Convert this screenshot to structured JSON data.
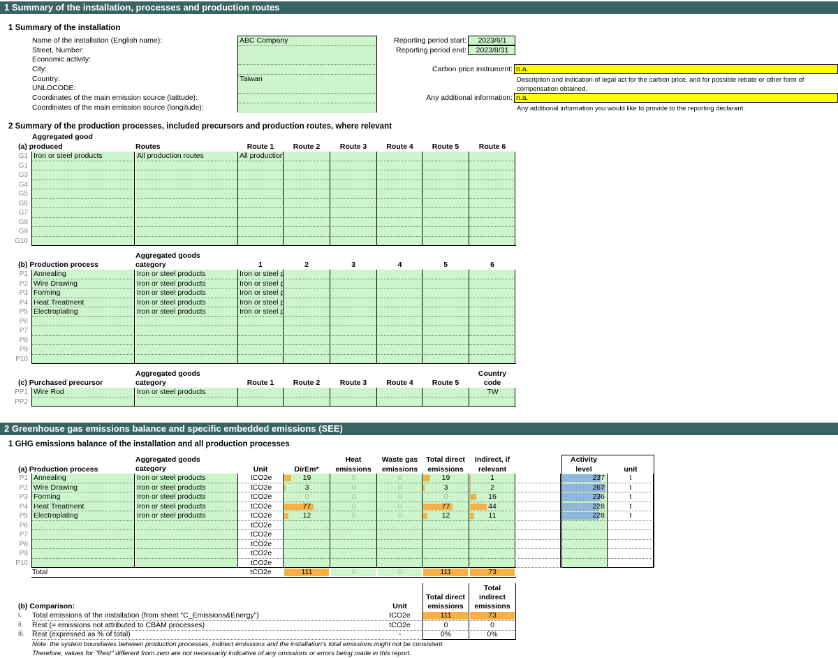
{
  "section1": {
    "title": "1  Summary of the installation, processes and production routes"
  },
  "inst": {
    "heading": "1  Summary of the installation",
    "labels": [
      "Name of the installation (English name):",
      "Street, Number:",
      "Economic activity:",
      "City:",
      "Country:",
      "UNLOCODE:",
      "Coordinates of the main emission source (latitude):",
      "Coordinates of the main emission source (longitude):"
    ],
    "name": "ABC Company",
    "country": "Taiwan",
    "period_start_label": "Reporting period start:",
    "period_start": "2023/6/1",
    "period_end_label": "Reporting period end:",
    "period_end": "2023/8/31",
    "carbon_label": "Carbon price instrument:",
    "carbon_value": "n.a.",
    "carbon_desc": "Description and indication of legal act for the carbon price, and for possible rebate or other form of",
    "carbon_desc2": "compensation obtained.",
    "additional_label": "Any additional information:",
    "additional_value": "n.a.",
    "additional_desc": "Any additional information you would like to provide to the reporting declarant."
  },
  "processes_heading": "2  Summary of the production processes, included precursors and production routes, where relevant",
  "goods": {
    "head1": "Aggregated good",
    "head2": "(a) produced",
    "routes_head": "Routes",
    "columns": [
      "Route 1",
      "Route 2",
      "Route 3",
      "Route 4",
      "Route 5",
      "Route 6"
    ],
    "index": [
      "G1",
      "G1",
      "G3",
      "G4",
      "G5",
      "G6",
      "G7",
      "G8",
      "G9",
      "G10"
    ],
    "first_good": "Iron or steel products",
    "first_route": "All production routes",
    "first_route1": "All production"
  },
  "proc": {
    "head1": "Aggregated goods",
    "head2": "category",
    "label": "(b) Production process",
    "columns": [
      "1",
      "2",
      "3",
      "4",
      "5",
      "6"
    ],
    "index": [
      "P1",
      "P2",
      "P3",
      "P4",
      "P5",
      "P6",
      "P7",
      "P8",
      "P9",
      "P10"
    ],
    "names": [
      "Annealing",
      "Wire Drawing",
      "Forming",
      "Heat Treatment",
      "Electroplating"
    ],
    "category": "Iron or steel products",
    "col1": "Iron or steel p"
  },
  "prec": {
    "head1": "Aggregated goods",
    "head2": "category",
    "label": "(c) Purchased precursor",
    "columns": [
      "Route 1",
      "Route 2",
      "Route 3",
      "Route 4",
      "Route 5"
    ],
    "country_head1": "Country",
    "country_head2": "code",
    "index": [
      "PP1",
      "PP2"
    ],
    "name": "Wire Rod",
    "category": "Iron or steel products",
    "country": "TW"
  },
  "section2": {
    "title": "2  Greenhouse gas emissions balance and specific embedded emissions (SEE)"
  },
  "ghg": {
    "heading": "1  GHG emissions balance of the installation and all production processes",
    "agg1": "Aggregated goods",
    "agg2": "category",
    "label": "(a) Production process",
    "unit_head": "Unit",
    "dirEm": "DirEm*",
    "heat1": "Heat",
    "heat2": "emissions",
    "waste1": "Waste gas",
    "waste2": "emissions",
    "tdir1": "Total direct",
    "tdir2": "emissions",
    "ind1": "Indirect, if",
    "ind2": "relevant",
    "act1": "Activity",
    "act2": "level",
    "unit2": "unit",
    "index": [
      "P1",
      "P2",
      "P3",
      "P4",
      "P5",
      "P6",
      "P7",
      "P8",
      "P9",
      "P10"
    ],
    "unit": "tCO2e",
    "rows": [
      {
        "name": "Annealing",
        "cat": "Iron or steel products",
        "dir": "19",
        "heat": "0",
        "waste": "0",
        "tdir": "19",
        "ind": "1",
        "act": "237",
        "aunit": "t"
      },
      {
        "name": "Wire Drawing",
        "cat": "Iron or steel products",
        "dir": "3",
        "heat": "0",
        "waste": "0",
        "tdir": "3",
        "ind": "2",
        "act": "267",
        "aunit": "t"
      },
      {
        "name": "Forming",
        "cat": "Iron or steel products",
        "dir": "0",
        "heat": "0",
        "waste": "0",
        "tdir": "0",
        "ind": "16",
        "act": "236",
        "aunit": "t"
      },
      {
        "name": "Heat Treatment",
        "cat": "Iron or steel products",
        "dir": "77",
        "heat": "0",
        "waste": "0",
        "tdir": "77",
        "ind": "44",
        "act": "228",
        "aunit": "t"
      },
      {
        "name": "Electroplating",
        "cat": "Iron or steel products",
        "dir": "12",
        "heat": "0",
        "waste": "0",
        "tdir": "12",
        "ind": "11",
        "act": "228",
        "aunit": "t"
      }
    ],
    "total_label": "Total",
    "total": {
      "dir": "111",
      "heat": "0",
      "waste": "0",
      "tdir": "111",
      "ind": "73"
    }
  },
  "cmp": {
    "label": "(b) Comparison:",
    "unit_head": "Unit",
    "tdir1": "Total direct",
    "tdir2": "emissions",
    "tind0": "Total",
    "tind1": "indirect",
    "tind2": "emissions",
    "rows": [
      {
        "idx": "i.",
        "label": "Total emissions of the installation (from sheet \"C_Emissions&Energy\")",
        "unit": "tCO2e",
        "dir": "111",
        "ind": "73"
      },
      {
        "idx": "ii.",
        "label": "Rest (= emissions not attributed to CBAM processes)",
        "unit": "tCO2e",
        "dir": "0",
        "ind": "0"
      },
      {
        "idx": "iii.",
        "label": "Rest (expressed as % of total)",
        "unit": "-",
        "dir": "0%",
        "ind": "0%"
      }
    ],
    "note1": "Note: the system boundaries between production processes, indirect emissions and the installation's total emissions might not be consistent.",
    "note2": "Therefore, values for \"Rest\" different from zero are not necessarily indicative of any omissions or errors being made in this report."
  },
  "colors": {
    "band": "#3a6464",
    "input": "#ccf5cc",
    "highlight": "#ffff00",
    "bar_orange": "#f7b044",
    "bar_blue": "#8fb7dc"
  }
}
